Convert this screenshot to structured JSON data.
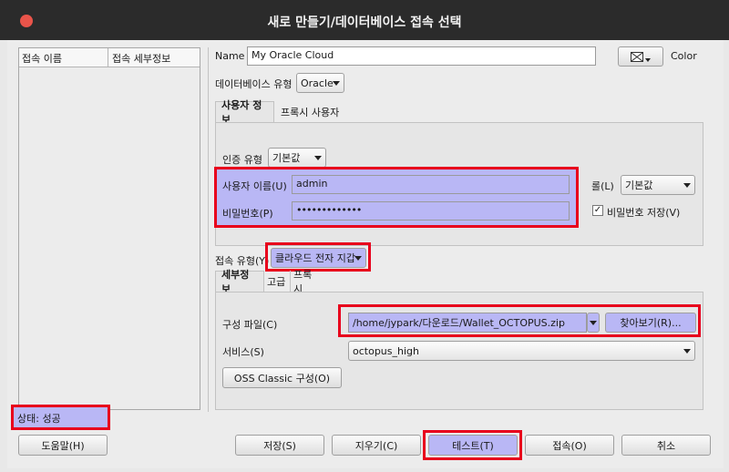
{
  "window": {
    "title": "새로 만들기/데이터베이스 접속 선택"
  },
  "list": {
    "col1": "접속 이름",
    "col2": "접속 세부정보"
  },
  "form": {
    "name_label": "Name",
    "name_value": "My Oracle Cloud",
    "color_label": "Color",
    "dbtype_label": "데이터베이스 유형",
    "dbtype_value": "Oracle",
    "tabs_top": [
      "사용자 정보",
      "프록시 사용자"
    ],
    "auth_label": "인증 유형",
    "auth_value": "기본값",
    "user_label": "사용자 이름(U)",
    "user_value": "admin",
    "pass_label": "비밀번호(P)",
    "pass_value": "•••••••••••••",
    "role_label": "롤(L)",
    "role_value": "기본값",
    "save_pw_label": "비밀번호 저장(V)",
    "conn_type_label": "접속 유형(Y)",
    "conn_type_value": "클라우드 전자 지갑",
    "tabs_bottom": [
      "세부정보",
      "고급",
      "프록시"
    ],
    "config_label": "구성 파일(C)",
    "config_value": "/home/jypark/다운로드/Wallet_OCTOPUS.zip",
    "browse_label": "찾아보기(R)...",
    "service_label": "서비스(S)",
    "service_value": "octopus_high",
    "oss_label": "OSS Classic 구성(O)"
  },
  "status": "상태: 성공",
  "buttons": {
    "help": "도움말(H)",
    "save": "저장(S)",
    "clear": "지우기(C)",
    "test": "테스트(T)",
    "connect": "접속(O)",
    "cancel": "취소"
  },
  "colors": {
    "highlight": "#b9b7f5",
    "annotation": "#e8001c"
  }
}
